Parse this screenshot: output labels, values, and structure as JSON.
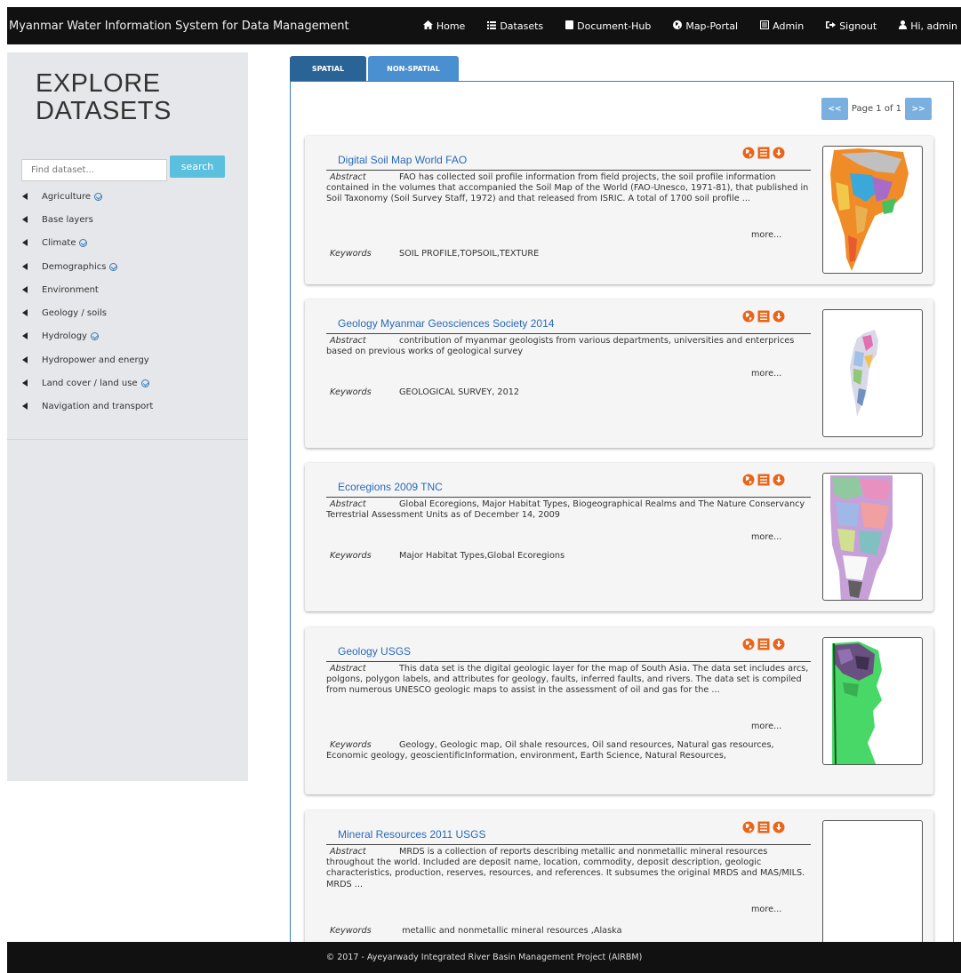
{
  "app": {
    "brand": "Myanmar Water Information System for Data Management"
  },
  "nav": [
    {
      "label": "Home",
      "icon": "home-icon"
    },
    {
      "label": "Datasets",
      "icon": "list-icon"
    },
    {
      "label": "Document-Hub",
      "icon": "book-icon"
    },
    {
      "label": "Map-Portal",
      "icon": "globe-icon"
    },
    {
      "label": "Admin",
      "icon": "list-alt-icon"
    },
    {
      "label": "Signout",
      "icon": "signout-icon"
    },
    {
      "label": "Hi, admin",
      "icon": "user-icon"
    }
  ],
  "sidebar": {
    "title": "EXPLORE\nDATASETS",
    "search": {
      "placeholder": "Find dataset...",
      "button": "search"
    },
    "categories": [
      {
        "label": "Agriculture",
        "checked": true
      },
      {
        "label": "Base layers",
        "checked": false
      },
      {
        "label": "Climate",
        "checked": true
      },
      {
        "label": "Demographics",
        "checked": true
      },
      {
        "label": "Environment",
        "checked": false
      },
      {
        "label": "Geology / soils",
        "checked": false
      },
      {
        "label": "Hydrology",
        "checked": true
      },
      {
        "label": "Hydropower and energy",
        "checked": false
      },
      {
        "label": "Land cover / land use",
        "checked": true
      },
      {
        "label": "Navigation and transport",
        "checked": false
      }
    ]
  },
  "tabs": {
    "spatial": "SPATIAL",
    "nonspatial": "NON-SPATIAL"
  },
  "pager": {
    "prev": "<<",
    "text": "Page 1 of 1",
    "next": ">>"
  },
  "labels": {
    "abstract": "Abstract",
    "keywords": "Keywords",
    "more": "more..."
  },
  "datasets": [
    {
      "title": "Digital Soil Map World FAO",
      "abstract": "FAO has collected soil profile information from field projects, the soil profile information contained in the volumes that accompanied the Soil Map of the World (FAO-Unesco, 1971-81), that published in Soil Taxonomy (Soil Survey Staff, 1972) and that released from ISRIC. A total of 1700 soil profile ...",
      "keywords": "SOIL PROFILE,TOPSOIL,TEXTURE"
    },
    {
      "title": "Geology Myanmar Geosciences Society 2014",
      "abstract": "contribution of myanmar geologists from various departments, universities and enterprices based on previous works of geological survey",
      "keywords": "GEOLOGICAL SURVEY, 2012"
    },
    {
      "title": "Ecoregions 2009 TNC",
      "abstract": "Global Ecoregions, Major Habitat Types, Biogeographical Realms and The Nature Conservancy Terrestrial Assessment Units as of December 14, 2009",
      "keywords": "Major Habitat Types,Global Ecoregions"
    },
    {
      "title": "Geology USGS",
      "abstract": "This data set is the digital geologic layer for the map of South Asia. The data set includes arcs, polgons, polygon labels, and attributes for geology, faults, inferred faults, and rivers. The data set is compiled from numerous UNESCO geologic maps to assist in the assessment of oil and gas for the ...",
      "keywords": "Geology, Geologic map, Oil shale resources, Oil sand resources, Natural gas resources, Economic geology, geoscientificInformation, environment, Earth Science, Natural Resources,"
    },
    {
      "title": "Mineral Resources 2011 USGS",
      "abstract": "MRDS is a collection of reports describing metallic and nonmetallic mineral resources throughout the world. Included are deposit name, location, commodity, deposit description, geologic characteristics, production, reserves, resources, and references. It subsumes the original MRDS and MAS/MILS. MRDS ...",
      "keywords": " metallic and nonmetallic mineral resources ,Alaska"
    }
  ],
  "footer": "© 2017 - Ayeyarwady Integrated River Basin Management Project (AIRBM)",
  "colors": {
    "nav_bg": "#111111",
    "accent": "#2a6496",
    "tab_light": "#4a8fd0",
    "search_btn": "#5bc0de",
    "icon_orange": "#e8651a",
    "link": "#2a6ab7"
  }
}
